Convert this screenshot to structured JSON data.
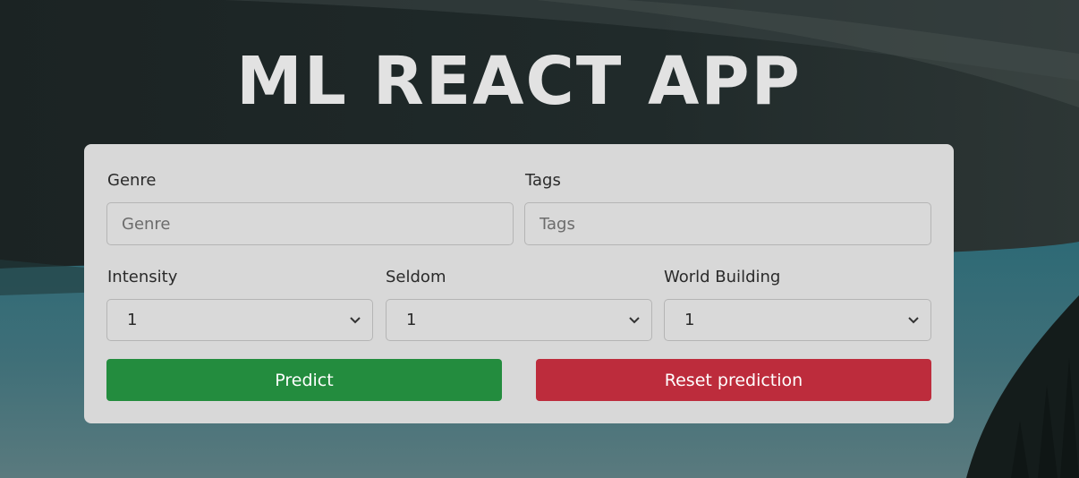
{
  "app": {
    "title": "ML REACT APP"
  },
  "form": {
    "genre": {
      "label": "Genre",
      "placeholder": "Genre"
    },
    "tags": {
      "label": "Tags",
      "placeholder": "Tags"
    },
    "intensity": {
      "label": "Intensity",
      "value": "1"
    },
    "seldom": {
      "label": "Seldom",
      "value": "1"
    },
    "world_building": {
      "label": "World Building",
      "value": "1"
    }
  },
  "actions": {
    "predict_label": "Predict",
    "reset_label": "Reset prediction"
  },
  "colors": {
    "predict": "#238c3e",
    "reset": "#bd2c3c",
    "card": "#d8d8d8",
    "title": "#e2e2e2"
  }
}
